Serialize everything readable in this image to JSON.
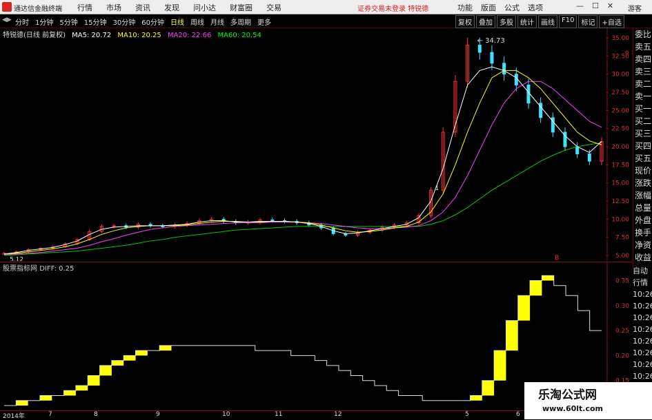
{
  "menubar": {
    "app_name": "通达信金融终端",
    "menus": [
      "行情",
      "市场",
      "资讯",
      "发现",
      "问小达",
      "财富圈",
      "交易"
    ],
    "notice": "证券交易未登录  特锐德",
    "right_menus": [
      "功能",
      "版面",
      "公式",
      "选项"
    ],
    "guest": "游客"
  },
  "periodbar": {
    "periods": [
      "分时",
      "1分钟",
      "5分钟",
      "15分钟",
      "30分钟",
      "60分钟",
      "日线",
      "周线",
      "月线",
      "多周期",
      "更多"
    ],
    "active_period": "日线",
    "right_buttons": [
      "复权",
      "叠加",
      "多股",
      "统计",
      "画线",
      "F10",
      "标记",
      "+自选"
    ]
  },
  "legend": {
    "name": "特锐德(日线 前复权)",
    "ma5": "MA5: 20.72",
    "ma10": "MA10: 20.25",
    "ma20": "MA20: 22.66",
    "ma60": "MA60: 20.54",
    "colors": {
      "ma5": "#ffffff",
      "ma10": "#ffff00",
      "ma20": "#ff40ff",
      "ma60": "#00ff00"
    }
  },
  "sublegend": {
    "name": "股票指标网",
    "diff": "DIFF: 0.25"
  },
  "annotations": {
    "high_label": "34.73",
    "low_label": "5.12",
    "marker_b": "B",
    "marker_1": "1"
  },
  "main_axis": [
    "35.00",
    "32.50",
    "30.00",
    "27.50",
    "25.00",
    "22.50",
    "20.00",
    "17.50",
    "15.00",
    "12.50",
    "10.00",
    "7.50",
    "5.00"
  ],
  "sub_axis": [
    "0.35",
    "0.30",
    "0.25",
    "0.20",
    "0.15"
  ],
  "right_list": [
    "委比",
    "卖五",
    "卖四",
    "卖三",
    "卖二",
    "卖一",
    "买一",
    "买二",
    "买三",
    "买四",
    "买五",
    "现价",
    "涨跌",
    "涨幅",
    "总量",
    "外盘",
    "换手",
    "净资",
    "收益"
  ],
  "right_list2": [
    "自动",
    "行情",
    "10:26",
    "10:26",
    "10:26",
    "10:26",
    "10:26",
    "10:26",
    "10:26",
    "10:26",
    "10:26",
    "10:26"
  ],
  "dates": [
    "2014年",
    "7",
    "8",
    "9",
    "10",
    "11",
    "12",
    "5",
    "6"
  ],
  "watermark": {
    "title": "乐淘公式网",
    "url": "www.60lt.com"
  },
  "chart_data": {
    "type": "line",
    "price_ylim": [
      5.0,
      35.0
    ],
    "price_close": [
      5.3,
      5.5,
      5.8,
      6.0,
      6.2,
      6.6,
      7.2,
      8.3,
      9.0,
      9.1,
      8.9,
      9.3,
      9.1,
      9.0,
      9.2,
      9.4,
      9.8,
      10.0,
      9.7,
      9.5,
      9.6,
      9.9,
      9.8,
      9.7,
      9.5,
      9.2,
      8.8,
      8.0,
      7.8,
      8.2,
      8.5,
      8.9,
      9.2,
      9.5,
      10.5,
      14.0,
      22.0,
      29.0,
      34.0,
      33.0,
      31.5,
      30.0,
      28.5,
      26.0,
      24.0,
      22.0,
      20.0,
      19.0,
      18.0,
      20.7
    ],
    "ma5": [
      5.2,
      5.4,
      5.7,
      5.9,
      6.1,
      6.5,
      7.0,
      7.9,
      8.6,
      8.9,
      9.0,
      9.1,
      9.1,
      9.1,
      9.2,
      9.3,
      9.6,
      9.8,
      9.8,
      9.6,
      9.6,
      9.7,
      9.7,
      9.7,
      9.6,
      9.4,
      9.0,
      8.4,
      8.0,
      8.1,
      8.4,
      8.7,
      9.0,
      9.3,
      10.2,
      12.5,
      17.0,
      23.0,
      28.5,
      30.5,
      31.0,
      30.5,
      29.5,
      27.5,
      25.5,
      23.5,
      21.5,
      20.0,
      19.2,
      20.72
    ],
    "ma10": [
      5.2,
      5.3,
      5.5,
      5.7,
      5.9,
      6.2,
      6.6,
      7.2,
      7.9,
      8.4,
      8.8,
      9.0,
      9.1,
      9.1,
      9.1,
      9.2,
      9.4,
      9.6,
      9.7,
      9.7,
      9.6,
      9.6,
      9.7,
      9.7,
      9.6,
      9.5,
      9.2,
      8.8,
      8.4,
      8.2,
      8.3,
      8.5,
      8.8,
      9.0,
      9.6,
      11.0,
      13.5,
      17.5,
      22.0,
      26.0,
      29.5,
      30.5,
      30.5,
      29.5,
      28.0,
      26.0,
      24.0,
      22.0,
      20.8,
      20.25
    ],
    "ma20": [
      5.1,
      5.2,
      5.3,
      5.4,
      5.6,
      5.8,
      6.0,
      6.4,
      6.9,
      7.3,
      7.8,
      8.2,
      8.6,
      8.8,
      9.0,
      9.1,
      9.2,
      9.3,
      9.4,
      9.5,
      9.5,
      9.5,
      9.6,
      9.6,
      9.6,
      9.5,
      9.4,
      9.2,
      9.0,
      8.8,
      8.7,
      8.7,
      8.8,
      8.9,
      9.1,
      9.8,
      11.0,
      13.0,
      16.0,
      19.5,
      23.0,
      26.0,
      28.0,
      29.0,
      29.0,
      28.0,
      26.5,
      25.0,
      23.5,
      22.66
    ],
    "ma60": [
      5.0,
      5.1,
      5.2,
      5.3,
      5.4,
      5.5,
      5.6,
      5.8,
      6.0,
      6.2,
      6.4,
      6.7,
      7.0,
      7.2,
      7.5,
      7.7,
      7.9,
      8.1,
      8.3,
      8.5,
      8.6,
      8.7,
      8.8,
      8.9,
      9.0,
      9.0,
      9.0,
      9.0,
      9.0,
      9.0,
      9.0,
      9.0,
      9.0,
      9.0,
      9.0,
      9.3,
      9.8,
      10.6,
      11.6,
      12.8,
      14.0,
      15.0,
      16.0,
      17.0,
      18.0,
      18.8,
      19.5,
      20.0,
      20.3,
      20.54
    ],
    "diff_ylim": [
      0.1,
      0.37
    ],
    "diff": [
      0.1,
      0.11,
      0.11,
      0.12,
      0.12,
      0.13,
      0.14,
      0.16,
      0.18,
      0.19,
      0.2,
      0.21,
      0.21,
      0.22,
      0.22,
      0.22,
      0.22,
      0.22,
      0.22,
      0.22,
      0.22,
      0.21,
      0.21,
      0.21,
      0.2,
      0.2,
      0.19,
      0.18,
      0.17,
      0.16,
      0.15,
      0.14,
      0.13,
      0.12,
      0.12,
      0.11,
      0.11,
      0.11,
      0.11,
      0.12,
      0.15,
      0.21,
      0.27,
      0.32,
      0.35,
      0.36,
      0.34,
      0.32,
      0.29,
      0.25
    ]
  }
}
